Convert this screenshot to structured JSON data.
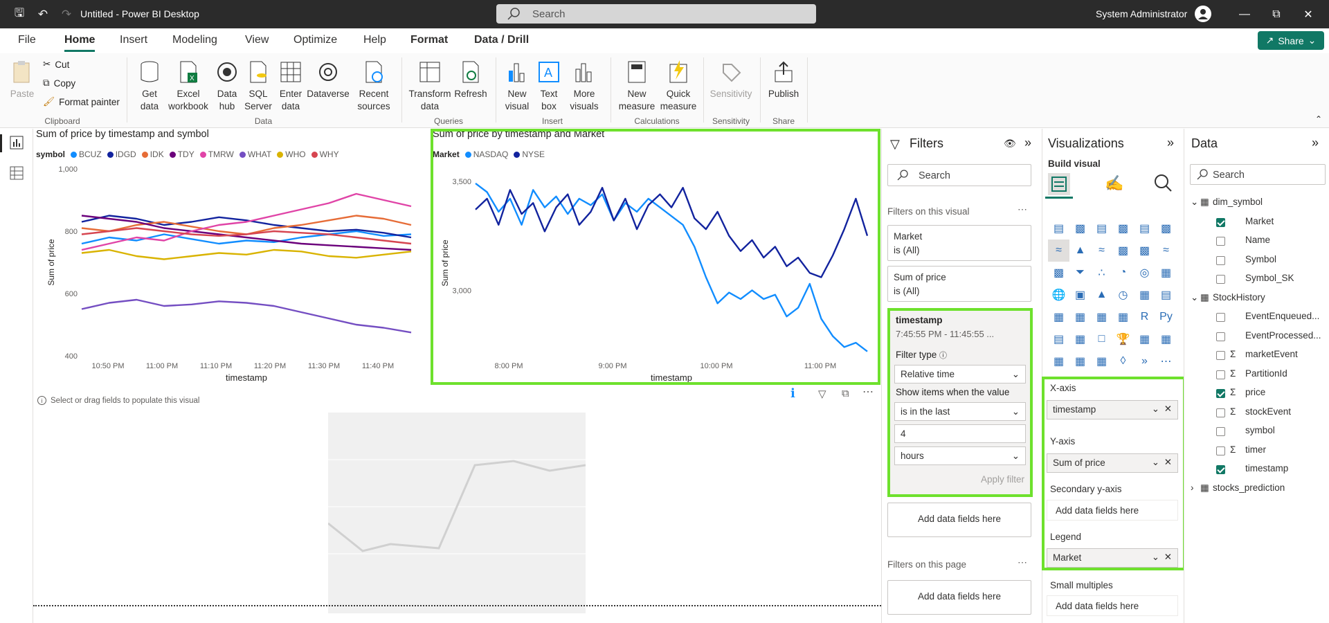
{
  "app": {
    "title": "Untitled - Power BI Desktop",
    "search_placeholder": "Search",
    "user": "System Administrator"
  },
  "menu": {
    "items": [
      "File",
      "Home",
      "Insert",
      "Modeling",
      "View",
      "Optimize",
      "Help",
      "Format",
      "Data / Drill"
    ],
    "active": "Home",
    "share_label": "Share"
  },
  "ribbon": {
    "clipboard": {
      "paste": "Paste",
      "cut": "Cut",
      "copy": "Copy",
      "format_painter": "Format painter",
      "group": "Clipboard"
    },
    "data": {
      "get_data": "Get data",
      "excel": "Excel workbook",
      "data_hub": "Data hub",
      "sql": "SQL Server",
      "enter": "Enter data",
      "dataverse": "Dataverse",
      "recent": "Recent sources",
      "group": "Data"
    },
    "queries": {
      "transform": "Transform data",
      "refresh": "Refresh",
      "group": "Queries"
    },
    "insert": {
      "new_visual": "New visual",
      "text_box": "Text box",
      "more_visuals": "More visuals",
      "group": "Insert"
    },
    "calculations": {
      "new_measure": "New measure",
      "quick_measure": "Quick measure",
      "group": "Calculations"
    },
    "sensitivity": {
      "label": "Sensitivity",
      "group": "Sensitivity"
    },
    "share": {
      "publish": "Publish",
      "group": "Share"
    }
  },
  "canvas": {
    "placeholder_text": "Select or drag fields to populate this visual"
  },
  "chart_data": [
    {
      "type": "line",
      "title": "Sum of price by timestamp and symbol",
      "legend_title": "symbol",
      "xlabel": "timestamp",
      "ylabel": "Sum of price",
      "x_ticks": [
        "10:50 PM",
        "11:00 PM",
        "11:10 PM",
        "11:20 PM",
        "11:30 PM",
        "11:40 PM"
      ],
      "y_ticks": [
        "1,000",
        "800",
        "600",
        "400"
      ],
      "ylim": [
        400,
        1000
      ],
      "series": [
        {
          "name": "BCUZ",
          "color": "#118dff",
          "values": [
            760,
            780,
            770,
            790,
            775,
            760,
            770,
            765,
            780,
            790,
            800,
            785,
            790
          ]
        },
        {
          "name": "IDGD",
          "color": "#12239e",
          "values": [
            830,
            850,
            840,
            820,
            830,
            845,
            835,
            820,
            810,
            800,
            805,
            795,
            780
          ]
        },
        {
          "name": "IDK",
          "color": "#e66c37",
          "values": [
            810,
            800,
            820,
            830,
            815,
            800,
            790,
            810,
            820,
            835,
            850,
            840,
            820
          ]
        },
        {
          "name": "TDY",
          "color": "#6b007b",
          "values": [
            850,
            840,
            830,
            810,
            800,
            790,
            780,
            770,
            760,
            755,
            750,
            745,
            740
          ]
        },
        {
          "name": "TMRW",
          "color": "#e044a7",
          "values": [
            740,
            760,
            780,
            770,
            800,
            820,
            830,
            850,
            870,
            890,
            920,
            900,
            880
          ]
        },
        {
          "name": "WHAT",
          "color": "#744ec2",
          "values": [
            550,
            570,
            580,
            560,
            565,
            575,
            570,
            560,
            540,
            520,
            500,
            490,
            475
          ]
        },
        {
          "name": "WHO",
          "color": "#d9b300",
          "values": [
            730,
            740,
            720,
            710,
            720,
            730,
            725,
            740,
            735,
            720,
            715,
            725,
            735
          ]
        },
        {
          "name": "WHY",
          "color": "#d64550",
          "values": [
            790,
            800,
            810,
            800,
            790,
            785,
            790,
            800,
            795,
            790,
            780,
            770,
            760
          ]
        }
      ]
    },
    {
      "type": "line",
      "title": "Sum of price by timestamp and Market",
      "legend_title": "Market",
      "xlabel": "timestamp",
      "ylabel": "Sum of price",
      "x_ticks": [
        "8:00 PM",
        "9:00 PM",
        "10:00 PM",
        "11:00 PM"
      ],
      "y_ticks": [
        "3,500",
        "3,000"
      ],
      "ylim": [
        2700,
        3550
      ],
      "series": [
        {
          "name": "NASDAQ",
          "color": "#118dff",
          "values": [
            3490,
            3450,
            3360,
            3420,
            3300,
            3460,
            3380,
            3430,
            3350,
            3420,
            3390,
            3440,
            3320,
            3400,
            3360,
            3420,
            3380,
            3340,
            3300,
            3200,
            3060,
            2940,
            2990,
            2960,
            3000,
            2960,
            2980,
            2880,
            2920,
            3030,
            2870,
            2790,
            2740,
            2760,
            2720
          ]
        },
        {
          "name": "NYSE",
          "color": "#12239e",
          "values": [
            3370,
            3420,
            3300,
            3460,
            3350,
            3400,
            3270,
            3380,
            3440,
            3300,
            3360,
            3470,
            3320,
            3420,
            3280,
            3390,
            3440,
            3380,
            3470,
            3330,
            3280,
            3360,
            3250,
            3180,
            3230,
            3150,
            3200,
            3110,
            3150,
            3080,
            3060,
            3160,
            3280,
            3420,
            3250
          ]
        }
      ]
    }
  ],
  "filters": {
    "title": "Filters",
    "search_placeholder": "Search",
    "on_visual_label": "Filters on this visual",
    "cards": [
      {
        "name": "Market",
        "value": "is (All)"
      },
      {
        "name": "Sum of price",
        "value": "is (All)"
      }
    ],
    "timestamp_card": {
      "name": "timestamp",
      "range": "7:45:55 PM - 11:45:55 ...",
      "filter_type_label": "Filter type",
      "filter_type": "Relative time",
      "show_items_label": "Show items when the value",
      "condition": "is in the last",
      "amount": "4",
      "unit": "hours",
      "apply": "Apply filter"
    },
    "add_fields": "Add data fields here",
    "on_page_label": "Filters on this page"
  },
  "visualizations": {
    "title": "Visualizations",
    "build_visual": "Build visual",
    "wells": [
      {
        "label": "X-axis",
        "field": "timestamp"
      },
      {
        "label": "Y-axis",
        "field": "Sum of price"
      },
      {
        "label": "Secondary y-axis",
        "field": ""
      },
      {
        "label": "Legend",
        "field": "Market"
      },
      {
        "label": "Small multiples",
        "field": ""
      }
    ],
    "add_fields": "Add data fields here"
  },
  "data_pane": {
    "title": "Data",
    "search_placeholder": "Search",
    "tables": [
      {
        "name": "dim_symbol",
        "fields": [
          {
            "name": "Market",
            "checked": true,
            "sigma": false
          },
          {
            "name": "Name",
            "checked": false,
            "sigma": false
          },
          {
            "name": "Symbol",
            "checked": false,
            "sigma": false
          },
          {
            "name": "Symbol_SK",
            "checked": false,
            "sigma": false
          }
        ]
      },
      {
        "name": "StockHistory",
        "fields": [
          {
            "name": "EventEnqueued...",
            "checked": false,
            "sigma": false
          },
          {
            "name": "EventProcessed...",
            "checked": false,
            "sigma": false
          },
          {
            "name": "marketEvent",
            "checked": false,
            "sigma": true
          },
          {
            "name": "PartitionId",
            "checked": false,
            "sigma": true
          },
          {
            "name": "price",
            "checked": true,
            "sigma": true
          },
          {
            "name": "stockEvent",
            "checked": false,
            "sigma": true
          },
          {
            "name": "symbol",
            "checked": false,
            "sigma": false
          },
          {
            "name": "timer",
            "checked": false,
            "sigma": true
          },
          {
            "name": "timestamp",
            "checked": true,
            "sigma": false
          }
        ]
      },
      {
        "name": "stocks_prediction",
        "fields": []
      }
    ]
  }
}
